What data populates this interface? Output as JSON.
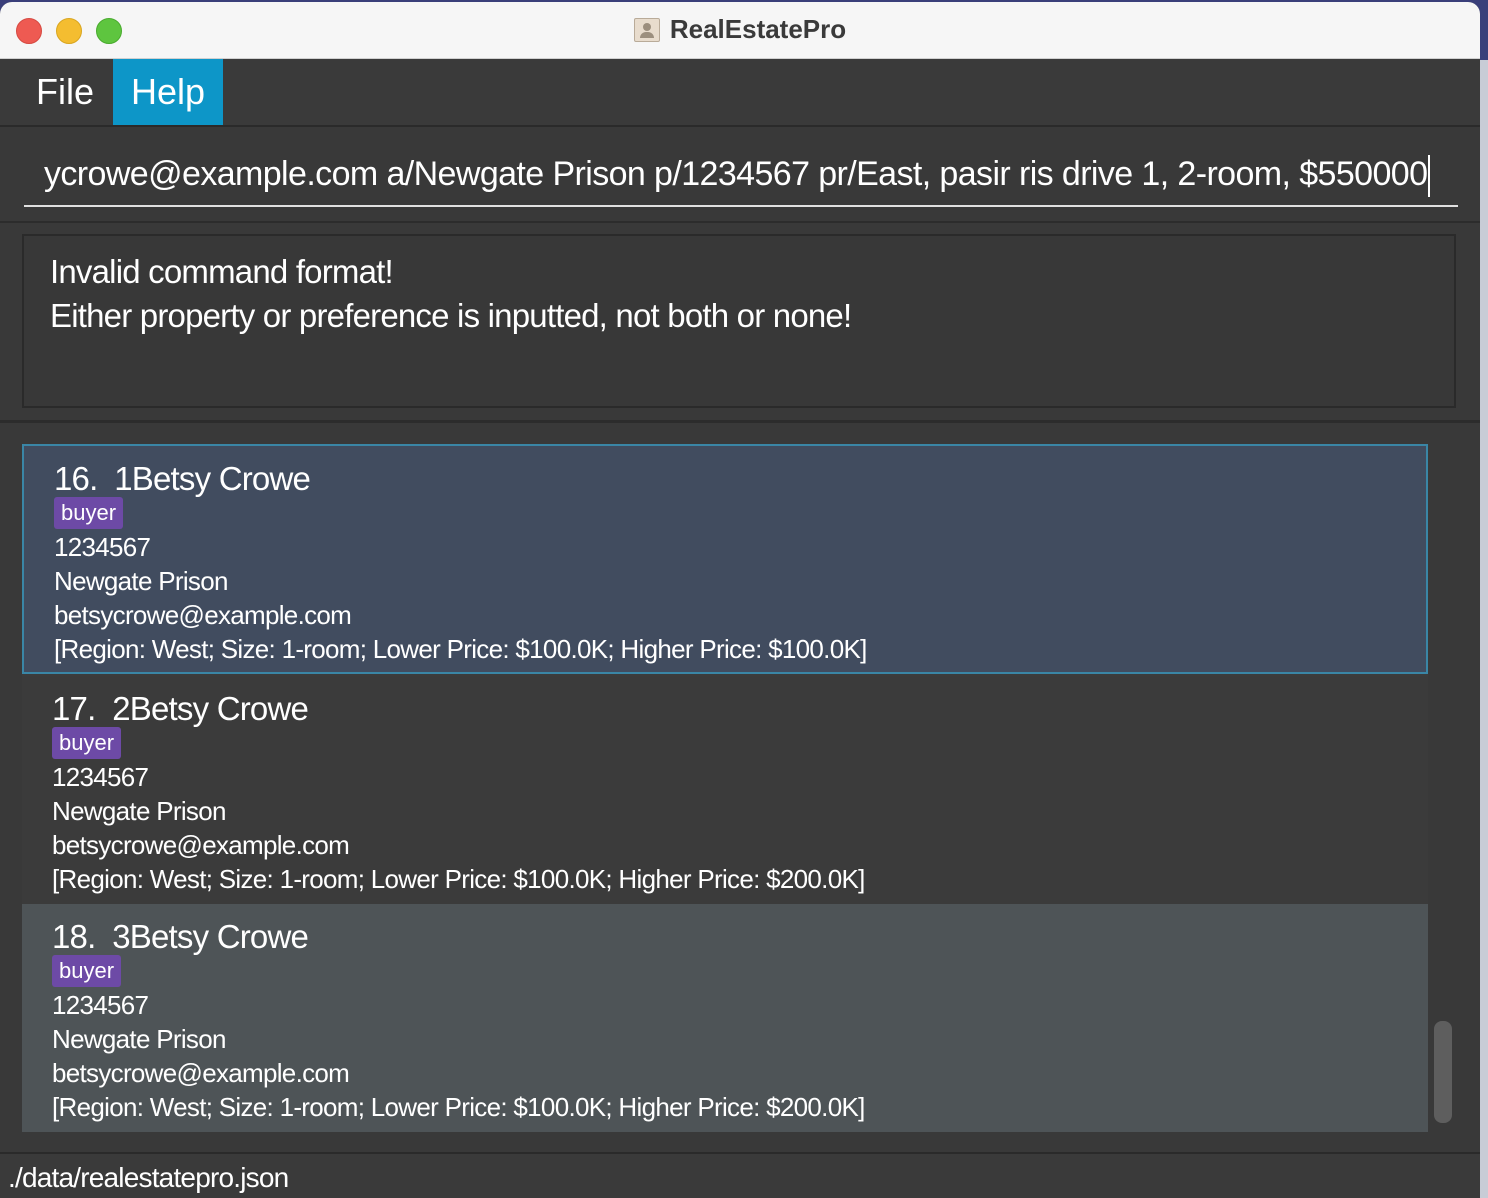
{
  "window": {
    "title": "RealEstatePro"
  },
  "menu": {
    "file": "File",
    "help": "Help"
  },
  "command": {
    "value": "ycrowe@example.com a/Newgate Prison p/1234567 pr/East, pasir ris drive 1, 2-room, $550000"
  },
  "result": {
    "line1": "Invalid command format!",
    "line2": "Either property or preference is inputted, not both or none!"
  },
  "persons": [
    {
      "index": "16.",
      "name": "1Betsy Crowe",
      "tag": "buyer",
      "phone": "1234567",
      "address": "Newgate Prison",
      "email": "betsycrowe@example.com",
      "preference": "[Region: West; Size: 1-room; Lower Price: $100.0K; Higher Price: $100.0K]",
      "selected": true
    },
    {
      "index": "17.",
      "name": "2Betsy Crowe",
      "tag": "buyer",
      "phone": "1234567",
      "address": "Newgate Prison",
      "email": "betsycrowe@example.com",
      "preference": "[Region: West; Size: 1-room; Lower Price: $100.0K; Higher Price: $200.0K]",
      "selected": false
    },
    {
      "index": "18.",
      "name": "3Betsy Crowe",
      "tag": "buyer",
      "phone": "1234567",
      "address": "Newgate Prison",
      "email": "betsycrowe@example.com",
      "preference": "[Region: West; Size: 1-room; Lower Price: $100.0K; Higher Price: $200.0K]",
      "selected": false
    }
  ],
  "status": {
    "path": "./data/realestatepro.json"
  },
  "colors": {
    "menu_active": "#0d96c8",
    "tag_bg": "#6d4aa6",
    "selected_card": "#414c5f",
    "selected_border": "#3a86a6"
  },
  "icons": [
    "close-icon",
    "minimize-icon",
    "maximize-icon",
    "app-icon"
  ]
}
